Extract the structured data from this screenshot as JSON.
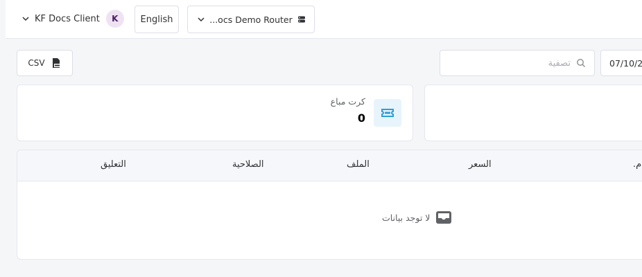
{
  "header": {
    "client_name": "KF Docs Client",
    "avatar_initial": "K",
    "language": "English",
    "router_name": "...ocs Demo Router"
  },
  "toolbar": {
    "csv_label": "CSV",
    "search_placeholder": "تصفية",
    "date_value": "07/10/2"
  },
  "stats": [
    {
      "label": "كرت مباع",
      "value": "0",
      "icon": "ticket-icon"
    }
  ],
  "table": {
    "columns": [
      "التعليق",
      "الصلاحية",
      "الملف",
      "السعر",
      "م."
    ],
    "empty_text": "لا توجد بيانات"
  },
  "colors": {
    "accent": "#2a9fd6",
    "avatar_bg": "#efe3f3",
    "avatar_text": "#4a1e63"
  }
}
